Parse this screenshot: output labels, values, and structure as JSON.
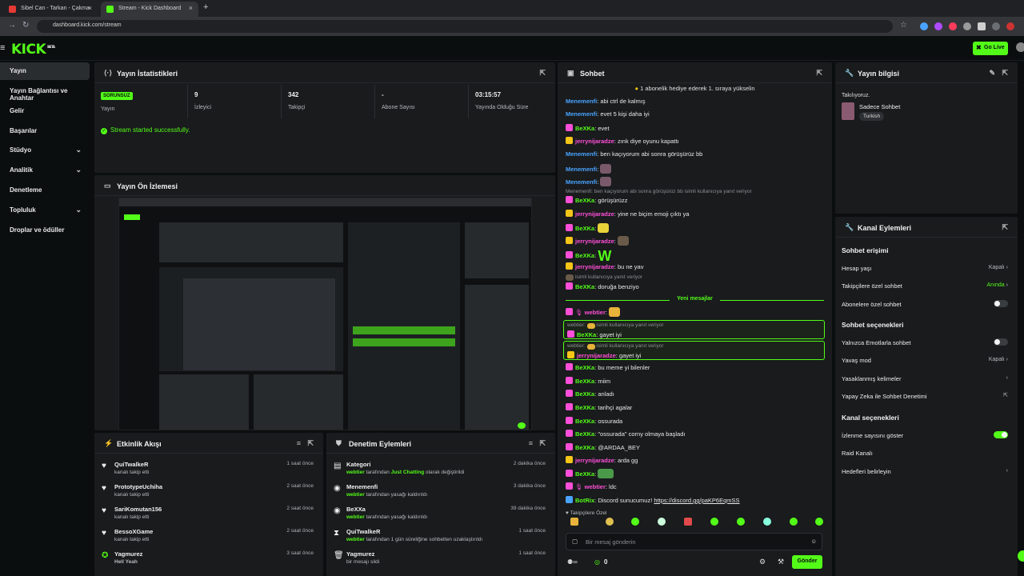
{
  "browser": {
    "tabs": [
      {
        "title": "Sibel Can - Tarkan - Çakma",
        "active": false
      },
      {
        "title": "Stream - Kick Dashboard",
        "active": true
      }
    ],
    "new_tab": "+",
    "url": "dashboard.kick.com/stream"
  },
  "header": {
    "logo": "KICK",
    "logo_sup": "BETA",
    "go_live": "Go Live"
  },
  "sidebar": {
    "items": [
      {
        "label": "Yayın",
        "active": true
      },
      {
        "label": "Yayın Bağlantısı ve Anahtar"
      },
      {
        "label": "Gelir"
      },
      {
        "label": "Başarılar"
      },
      {
        "label": "Stüdyo",
        "chevron": true
      },
      {
        "label": "Analitik",
        "chevron": true
      },
      {
        "label": "Denetleme"
      },
      {
        "label": "Topluluk",
        "chevron": true
      },
      {
        "label": "Droplar ve ödüller"
      }
    ]
  },
  "stats_panel": {
    "title": "Yayın İstatistikleri",
    "items": [
      {
        "value": "SORUNSUZ",
        "label": "Yayın"
      },
      {
        "value": "9",
        "label": "İzleyici"
      },
      {
        "value": "342",
        "label": "Takipçi"
      },
      {
        "value": "-",
        "label": "Abone Sayısı"
      },
      {
        "value": "03:15:57",
        "label": "Yayında Olduğu Süre"
      }
    ],
    "success": "Stream started successfully."
  },
  "preview_panel": {
    "title": "Yayın Ön İzlemesi"
  },
  "activity_panel": {
    "title": "Etkinlik Akışı",
    "rows": [
      {
        "name": "QuiTwalkeR",
        "sub": "kanalı takip etti",
        "time": "1 saat önce"
      },
      {
        "name": "PrototypeUchiha",
        "sub": "kanalı takip etti",
        "time": "2 saat önce"
      },
      {
        "name": "SariKomutan156",
        "sub": "kanalı takip etti",
        "time": "2 saat önce"
      },
      {
        "name": "BessoXGame",
        "sub": "kanalı takip etti",
        "time": "2 saat önce"
      },
      {
        "name": "Yagmurez",
        "sub": "Hell Yeah",
        "time": "3 saat önce"
      }
    ]
  },
  "moderation_panel": {
    "title": "Denetim Eylemleri",
    "rows": [
      {
        "name": "Kategori",
        "actor": "webtier",
        "mid": " tarafından ",
        "target": "Just Chatting",
        "end": " olarak değiştirildi",
        "time": "2 dakika önce"
      },
      {
        "name": "Menemenfi",
        "actor": "webtier",
        "mid": " tarafından yasağı kaldırıldı",
        "target": "",
        "end": "",
        "time": "3 dakika önce"
      },
      {
        "name": "BeXXa",
        "actor": "webtier",
        "mid": " tarafından yasağı kaldırıldı",
        "target": "",
        "end": "",
        "time": "39 dakika önce"
      },
      {
        "name": "QuiTwalkeR",
        "actor": "webtier",
        "mid": " tarafından 1 gün süreliğine sohbetten uzaklaştırıldı",
        "target": "",
        "end": "",
        "time": "1 saat önce"
      },
      {
        "name": "Yagmurez",
        "actor": "",
        "mid": "bir mesajı sildi",
        "target": "",
        "end": "",
        "time": "1 saat önce"
      }
    ]
  },
  "chat": {
    "title": "Sohbet",
    "pinned": "1 abonelik hediye ederek 1. sıraya yükselin",
    "messages": [
      {
        "user": "Menemenfi",
        "text": ": abi ctrl de kalmış",
        "color": "#4aa3ff"
      },
      {
        "user": "Menemenfi",
        "text": ": evet 5 kişi daha iyi",
        "color": "#4aa3ff"
      },
      {
        "user": "BeXKa",
        "text": ": evet",
        "color": "#53fc18"
      },
      {
        "user": "jerrynijaradze",
        "text": ": zınk diye oyunu kapattı",
        "color": "#ff4fd8"
      },
      {
        "user": "Menemenfi",
        "text": ": ben kaçıyorum abi sonra görüşürüz bb",
        "color": "#4aa3ff"
      },
      {
        "user": "Menemenfi",
        "text": ":",
        "color": "#4aa3ff"
      },
      {
        "user": "Menemenfi",
        "text": ":",
        "color": "#4aa3ff"
      },
      {
        "user": "BeXKa",
        "text": ": görüşürüzz",
        "color": "#53fc18"
      },
      {
        "user": "jerrynijaradze",
        "text": ": yine ne biçim emoji çıktı ya",
        "color": "#ff4fd8"
      },
      {
        "user": "BeXKa",
        "text": ":",
        "color": "#53fc18"
      },
      {
        "user": "jerrynijaradze",
        "text": ":",
        "color": "#ff4fd8"
      },
      {
        "user": "BeXKa",
        "text": ":",
        "color": "#53fc18"
      },
      {
        "user": "jerrynijaradze",
        "text": ": bu ne yav",
        "color": "#ff4fd8"
      },
      {
        "user": "BeXKa",
        "text": ": doruğa benziyo",
        "color": "#53fc18"
      }
    ],
    "reply1": "Menemenfi: ben kaçıyorum abi sonra görüşürüz bb isimli kullanıcıya yanıt veriyor",
    "reply2": "isimli kullanıcıya yanıt veriyor",
    "big_w": "W",
    "new_messages": "Yeni mesajlar",
    "messages2": [
      {
        "user": "webtier",
        "text": ":",
        "color": "#ff4fd8"
      },
      {
        "user": "BeXKa",
        "text": ": gayet iyi",
        "color": "#53fc18"
      },
      {
        "user": "jerrynijaradze",
        "text": ": gayet iyi",
        "color": "#ff4fd8"
      },
      {
        "user": "BeXKa",
        "text": ": bu meme yi bilenler",
        "color": "#53fc18"
      },
      {
        "user": "BeXKa",
        "text": ": miim",
        "color": "#53fc18"
      },
      {
        "user": "BeXKa",
        "text": ": anladı",
        "color": "#53fc18"
      },
      {
        "user": "BeXKa",
        "text": ": tarihçi agalar",
        "color": "#53fc18"
      },
      {
        "user": "BeXKa",
        "text": ": ossurada",
        "color": "#53fc18"
      },
      {
        "user": "BeXKa",
        "text": ": \"ossurada\" corny olmaya başladı",
        "color": "#53fc18"
      },
      {
        "user": "BeXKa",
        "text": ": @ARDAA_BEY",
        "color": "#53fc18"
      },
      {
        "user": "jerrynijaradze",
        "text": ": arda gg",
        "color": "#ff4fd8"
      },
      {
        "user": "BeXKa",
        "text": ":",
        "color": "#53fc18"
      },
      {
        "user": "webtier",
        "text": ": ldc",
        "color": "#ff4fd8"
      },
      {
        "user": "BotRix",
        "text": ": Discord sunucumuz! ",
        "link": "https://discord.gg/paKP6EqmSS",
        "color": "#53fc18"
      }
    ],
    "highlight_reply1": "webtier:",
    "highlight_reply_suffix": "isimli kullanıcıya yanıt veriyor",
    "followers_only": "Takipçilere Özel",
    "input_placeholder": "Bir mesaj gönderin",
    "points": "0",
    "send": "Gönder"
  },
  "stream_info": {
    "title": "Yayın bilgisi",
    "category_label": "Takılıyoruz.",
    "category": "Sadece Sohbet",
    "tag": "Turkish"
  },
  "channel_actions": {
    "title": "Kanal Eylemleri",
    "sections": {
      "chat_access": "Sohbet erişimi",
      "chat_options": "Sohbet seçenekleri",
      "channel_options": "Kanal seçenekleri"
    },
    "rows": {
      "account_age": {
        "label": "Hesap yaşı",
        "value": "Kapalı"
      },
      "followers_only": {
        "label": "Takipçilere özel sohbet",
        "value": "Anında"
      },
      "subs_only": {
        "label": "Abonelere özel sohbet"
      },
      "emotes_only": {
        "label": "Yalnızca Emotlarla sohbet"
      },
      "slow_mode": {
        "label": "Yavaş mod",
        "value": "Kapalı"
      },
      "banned_words": {
        "label": "Yasaklanmış kelimeler"
      },
      "ai_mod": {
        "label": "Yapay Zeka ile Sohbet Denetimi"
      },
      "viewer_count": {
        "label": "İzlenme sayısını göster"
      },
      "raid": {
        "label": "Raid Kanalı"
      },
      "goals": {
        "label": "Hedefleri belirleyin"
      }
    }
  },
  "colors": {
    "accent": "#53fc18",
    "bg": "#0b0e0f",
    "panel": "#191b1d"
  }
}
